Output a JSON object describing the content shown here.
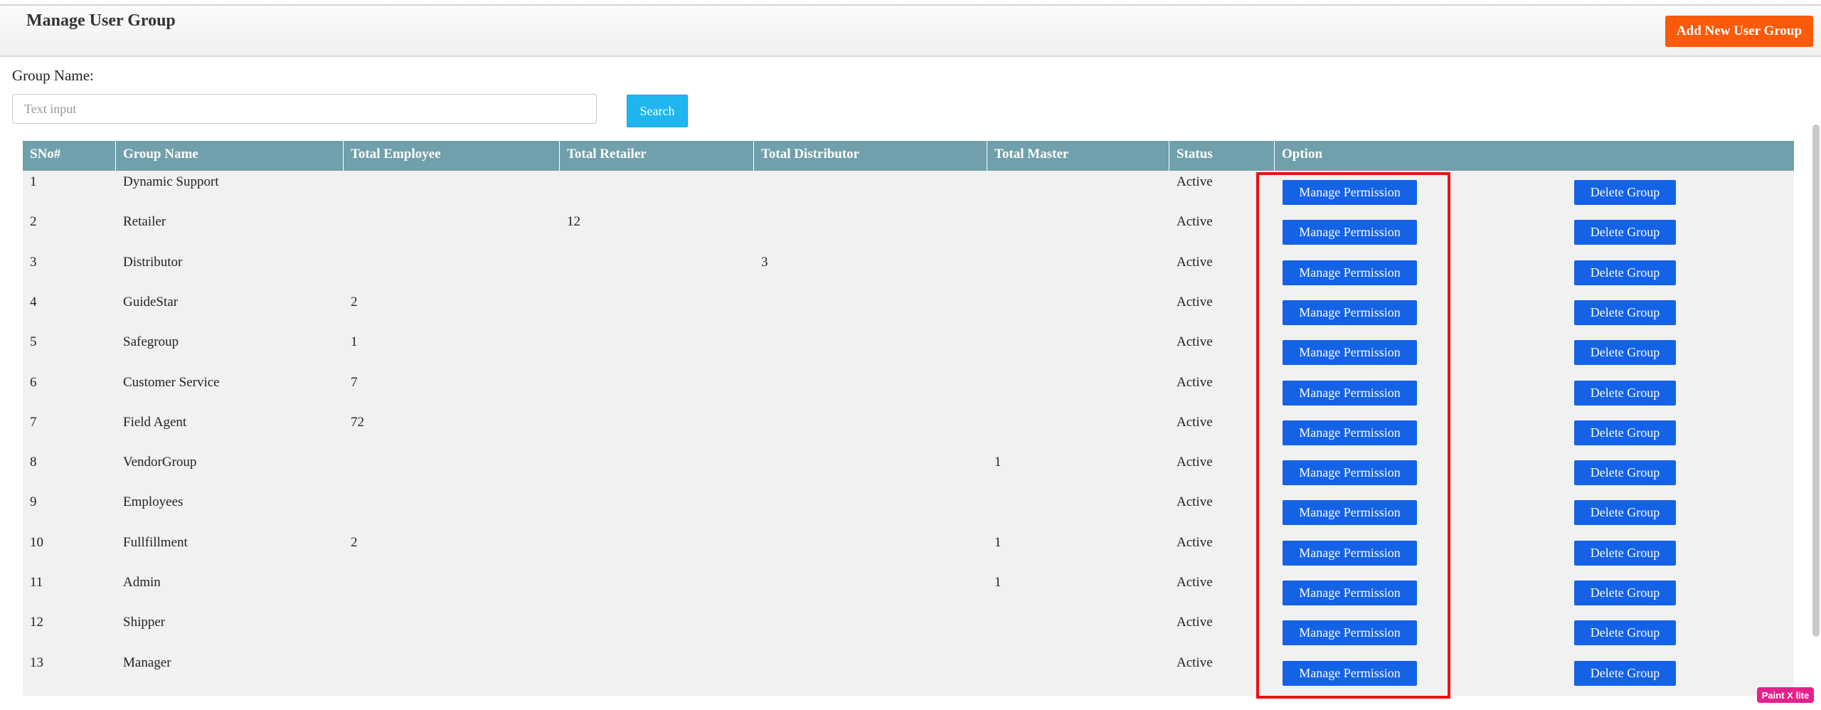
{
  "header": {
    "title": "Manage User Group",
    "add_button": "Add New User Group"
  },
  "search": {
    "label": "Group Name:",
    "placeholder": "Text input",
    "button": "Search"
  },
  "table": {
    "columns": [
      "SNo#",
      "Group Name",
      "Total Employee",
      "Total Retailer",
      "Total Distributor",
      "Total Master",
      "Status",
      "Option"
    ],
    "rows": [
      {
        "sno": "1",
        "name": "Dynamic Support",
        "employee": "",
        "retailer": "",
        "distributor": "",
        "master": "",
        "status": "Active"
      },
      {
        "sno": "2",
        "name": "Retailer",
        "employee": "",
        "retailer": "12",
        "distributor": "",
        "master": "",
        "status": "Active"
      },
      {
        "sno": "3",
        "name": "Distributor",
        "employee": "",
        "retailer": "",
        "distributor": "3",
        "master": "",
        "status": "Active"
      },
      {
        "sno": "4",
        "name": "GuideStar",
        "employee": "2",
        "retailer": "",
        "distributor": "",
        "master": "",
        "status": "Active"
      },
      {
        "sno": "5",
        "name": "Safegroup",
        "employee": "1",
        "retailer": "",
        "distributor": "",
        "master": "",
        "status": "Active"
      },
      {
        "sno": "6",
        "name": "Customer Service",
        "employee": "7",
        "retailer": "",
        "distributor": "",
        "master": "",
        "status": "Active"
      },
      {
        "sno": "7",
        "name": "Field Agent",
        "employee": "72",
        "retailer": "",
        "distributor": "",
        "master": "",
        "status": "Active"
      },
      {
        "sno": "8",
        "name": "VendorGroup",
        "employee": "",
        "retailer": "",
        "distributor": "",
        "master": "1",
        "status": "Active"
      },
      {
        "sno": "9",
        "name": "Employees",
        "employee": "",
        "retailer": "",
        "distributor": "",
        "master": "",
        "status": "Active"
      },
      {
        "sno": "10",
        "name": "Fullfillment",
        "employee": "2",
        "retailer": "",
        "distributor": "",
        "master": "1",
        "status": "Active"
      },
      {
        "sno": "11",
        "name": "Admin",
        "employee": "",
        "retailer": "",
        "distributor": "",
        "master": "1",
        "status": "Active"
      },
      {
        "sno": "12",
        "name": "Shipper",
        "employee": "",
        "retailer": "",
        "distributor": "",
        "master": "",
        "status": "Active"
      },
      {
        "sno": "13",
        "name": "Manager",
        "employee": "",
        "retailer": "",
        "distributor": "",
        "master": "",
        "status": "Active"
      }
    ],
    "manage_label": "Manage Permission",
    "delete_label": "Delete Group"
  },
  "colors": {
    "header_row": "#70a0ab",
    "action_button": "#1462e6",
    "add_button": "#fa5a0a",
    "search_button": "#1fb6f0",
    "highlight": "#ee1111"
  },
  "watermark": "Paint X lite"
}
